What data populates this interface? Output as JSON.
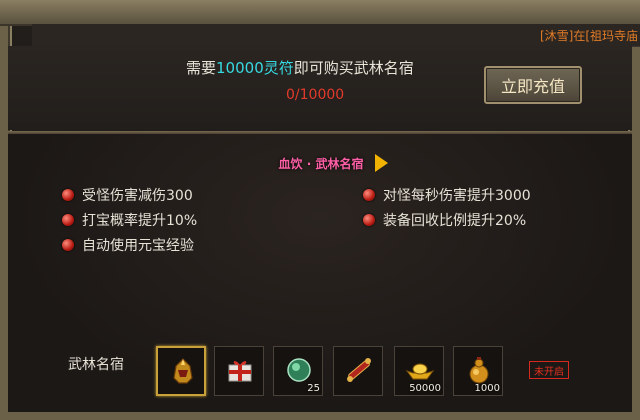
{
  "notice": "[沐雪]在[祖玛寺庙",
  "requirement": {
    "prefix": "需要",
    "amount": "10000灵符",
    "suffix": "即可购买武林名宿"
  },
  "progress": "0/10000",
  "recharge_button": "立即充值",
  "title_banner": "血饮 · 武林名宿",
  "effects_left": [
    "受怪伤害减伤300",
    "打宝概率提升10%",
    "自动使用元宝经验"
  ],
  "effects_right": [
    "对怪每秒伤害提升3000",
    "装备回收比例提升20%"
  ],
  "rewards_label": "武林名宿",
  "rewards": [
    {
      "icon": "golden-helmet-icon",
      "count": ""
    },
    {
      "icon": "gift-box-icon",
      "count": ""
    },
    {
      "icon": "green-gem-icon",
      "count": "25"
    },
    {
      "icon": "scroll-icon",
      "count": ""
    },
    {
      "icon": "gold-ingot-icon",
      "count": "50000"
    },
    {
      "icon": "potion-gourd-icon",
      "count": "1000"
    }
  ],
  "status_badge": "未开启",
  "colors": {
    "accent_cyan": "#37d9e2",
    "progress_red": "#e23a2a",
    "banner_pink": "#ff5fa6"
  }
}
